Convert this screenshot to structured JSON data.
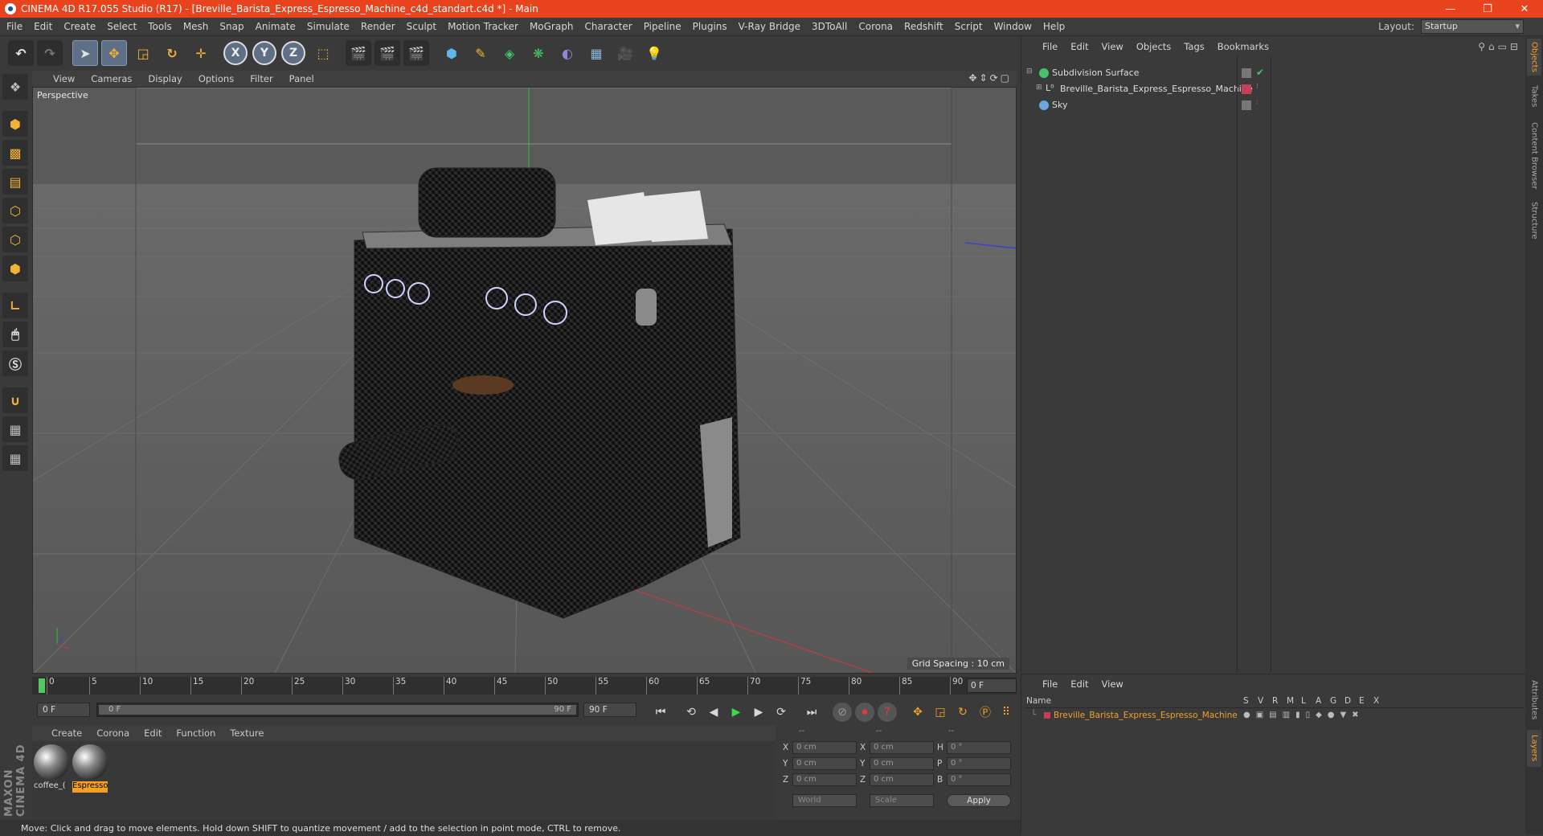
{
  "window": {
    "title": "CINEMA 4D R17.055 Studio (R17) - [Breville_Barista_Express_Espresso_Machine_c4d_standart.c4d *] - Main",
    "minimize": "—",
    "restore": "❐",
    "close": "✕"
  },
  "menubar": {
    "items": [
      "File",
      "Edit",
      "Create",
      "Select",
      "Tools",
      "Mesh",
      "Snap",
      "Animate",
      "Simulate",
      "Render",
      "Sculpt",
      "Motion Tracker",
      "MoGraph",
      "Character",
      "Pipeline",
      "Plugins",
      "V-Ray Bridge",
      "3DToAll",
      "Corona",
      "Redshift",
      "Script",
      "Window",
      "Help"
    ],
    "layout_label": "Layout:",
    "layout_value": "Startup"
  },
  "toolbar": {
    "axis_x": "X",
    "axis_y": "Y",
    "axis_z": "Z"
  },
  "viewport": {
    "menu": [
      "View",
      "Cameras",
      "Display",
      "Options",
      "Filter",
      "Panel"
    ],
    "label": "Perspective",
    "grid_spacing": "Grid Spacing : 10 cm"
  },
  "timeline": {
    "ticks": [
      "0",
      "5",
      "10",
      "15",
      "20",
      "25",
      "30",
      "35",
      "40",
      "45",
      "50",
      "55",
      "60",
      "65",
      "70",
      "75",
      "80",
      "85",
      "90"
    ],
    "current_frame": "0 F",
    "start_field": "0 F",
    "slider_start": "0 F",
    "slider_end": "90 F",
    "end_field": "90 F"
  },
  "material_manager": {
    "menu": [
      "Create",
      "Corona",
      "Edit",
      "Function",
      "Texture"
    ],
    "materials": [
      {
        "label": "coffee_("
      },
      {
        "label": "Espresso"
      }
    ]
  },
  "coordinates": {
    "headers": [
      "--",
      "--",
      "--"
    ],
    "rows": [
      {
        "a1": "X",
        "v1": "0 cm",
        "a2": "X",
        "v2": "0 cm",
        "a3": "H",
        "v3": "0 °"
      },
      {
        "a1": "Y",
        "v1": "0 cm",
        "a2": "Y",
        "v2": "0 cm",
        "a3": "P",
        "v3": "0 °"
      },
      {
        "a1": "Z",
        "v1": "0 cm",
        "a2": "Z",
        "v2": "0 cm",
        "a3": "B",
        "v3": "0 °"
      }
    ],
    "world": "World",
    "scale": "Scale",
    "apply": "Apply"
  },
  "status": {
    "text": "Move: Click and drag to move elements. Hold down SHIFT to quantize movement / add to the selection in point mode, CTRL to remove."
  },
  "logo": {
    "text": "MAXON CINEMA 4D"
  },
  "object_manager": {
    "menu": [
      "File",
      "Edit",
      "View",
      "Objects",
      "Tags",
      "Bookmarks"
    ],
    "objects": [
      {
        "name": "Subdivision Surface"
      },
      {
        "name": "Breville_Barista_Express_Espresso_Machine"
      },
      {
        "name": "Sky"
      }
    ]
  },
  "layer_manager": {
    "menu": [
      "File",
      "Edit",
      "View"
    ],
    "columns": [
      "Name",
      "S",
      "V",
      "R",
      "M",
      "L",
      "A",
      "G",
      "D",
      "E",
      "X"
    ],
    "layer_name": "Breville_Barista_Express_Espresso_Machine"
  },
  "side_tabs": [
    "Objects",
    "Takes",
    "Content Browser",
    "Structure",
    "Attributes",
    "Layers"
  ],
  "colors": {
    "titlebar": "#e8431c",
    "accent": "#f2a02a",
    "layer_color": "#c63e58"
  }
}
